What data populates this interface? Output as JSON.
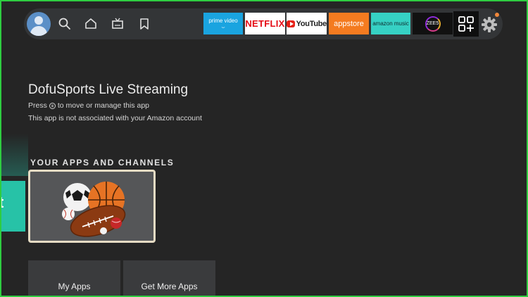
{
  "nav": {
    "apps": [
      {
        "name": "prime-video",
        "label_top": "prime video",
        "label_bottom": "⌣"
      },
      {
        "name": "netflix",
        "label": "NETFLIX"
      },
      {
        "name": "youtube",
        "label": "YouTube"
      },
      {
        "name": "appstore",
        "label": "appstore"
      },
      {
        "name": "amazon-music",
        "label": "amazon music"
      },
      {
        "name": "zee5",
        "label": "ZEE5"
      }
    ],
    "icons": [
      "profile-avatar",
      "search-icon",
      "home-icon",
      "live-tv-icon",
      "bookmark-icon",
      "apps-grid-icon",
      "settings-gear-icon"
    ],
    "accent_notify": "#f0873a"
  },
  "info": {
    "title": "DofuSports Live Streaming",
    "hint_pre": "Press",
    "hint_post": "to move or manage this app",
    "account_note": "This app is not associated with your Amazon account"
  },
  "section": {
    "title": "YOUR APPS AND CHANNELS",
    "partial_tile_letter": "t"
  },
  "bottom": {
    "my_apps": "My Apps",
    "get_more_apps": "Get More Apps"
  },
  "colors": {
    "background": "#252525",
    "focus_border": "#e6dcc4",
    "teal_tile": "#27c2a7"
  }
}
